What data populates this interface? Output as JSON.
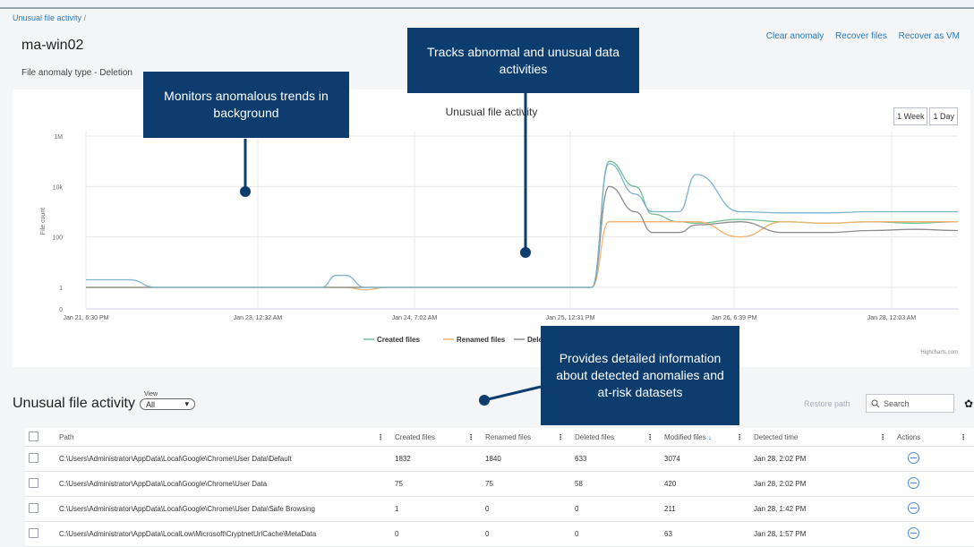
{
  "breadcrumb": {
    "item": "Unusual file activity",
    "separator": "/"
  },
  "page": {
    "title": "ma-win02",
    "subtitle": "File anomaly type - Deletion"
  },
  "top_actions": [
    "Clear anomaly",
    "Recover files",
    "Recover as VM"
  ],
  "chart_buttons": [
    "1 Week",
    "1 Day"
  ],
  "credits": "Highcharts.com",
  "chart_data": {
    "type": "line",
    "title": "Unusual file activity",
    "ylabel": "File count",
    "yscale": "log",
    "yticks": [
      {
        "label": "0",
        "value": 0
      },
      {
        "label": "1",
        "value": 1
      },
      {
        "label": "100",
        "value": 100
      },
      {
        "label": "10k",
        "value": 10000
      },
      {
        "label": "1M",
        "value": 1000000
      }
    ],
    "xticks": [
      "Jan 21, 6:30 PM",
      "Jan 23, 12:32 AM",
      "Jan 24, 7:02 AM",
      "Jan 25, 12:31 PM",
      "Jan 26, 6:39 PM",
      "Jan 28, 12:03 AM"
    ],
    "x_index": [
      0,
      0.8,
      1.0,
      1.6,
      1.8,
      3.0,
      3.3,
      3.7,
      4.0,
      4.5,
      5.0,
      5.4,
      5.75,
      5.95,
      6.4,
      6.9,
      7.3,
      7.9,
      8.6,
      9.5,
      10.0,
      10.7,
      11.2,
      11.6,
      12.0,
      12.6,
      13.0,
      13.6,
      14.0,
      15.0,
      16.0,
      17.0,
      18.0,
      19.0,
      20.0
    ],
    "series": [
      {
        "name": "Created files",
        "color": "#6fbf95",
        "values": [
          0,
          0,
          0,
          0,
          0,
          0,
          0,
          0,
          0,
          0,
          0,
          0,
          0,
          0,
          0,
          0,
          0,
          0,
          0,
          0,
          0,
          0,
          0,
          0,
          0,
          0,
          0,
          0,
          0,
          0,
          0,
          0,
          0,
          0,
          0
        ]
      },
      {
        "name": "Renamed files",
        "color": "#f2b36d",
        "values": [
          0,
          0,
          0,
          0,
          0,
          0,
          0,
          0,
          0,
          0,
          0,
          0,
          0,
          0,
          0,
          0,
          0,
          0,
          0,
          0,
          0,
          0,
          0,
          0,
          0,
          0,
          0,
          0,
          0,
          0,
          0,
          0,
          0,
          0,
          0
        ]
      },
      {
        "name": "Deleted files",
        "color": "#8c8c8c",
        "values": [
          0,
          0,
          0,
          0,
          0,
          0,
          0,
          0,
          0,
          0,
          0,
          0,
          0,
          0,
          0,
          0,
          0,
          0,
          0,
          0,
          0,
          0,
          0,
          0,
          0,
          0,
          0,
          0,
          0,
          0,
          0,
          0,
          0,
          0,
          0
        ]
      },
      {
        "name": "Modified files",
        "color": "#7db3cf",
        "values": [
          0,
          0,
          0,
          0,
          0,
          0,
          0,
          0,
          0,
          0,
          0,
          0,
          0,
          0,
          0,
          0,
          0,
          0,
          0,
          0,
          0,
          0,
          0,
          0,
          0,
          0,
          0,
          0,
          0,
          0,
          0,
          0,
          0,
          0,
          0
        ]
      }
    ],
    "legend_visible": [
      "Created files",
      "Renamed files",
      "Deleted"
    ],
    "legend_position": "bottom-center",
    "grid": true
  },
  "table": {
    "heading": "Unusual file activity",
    "view_label": "View",
    "view_value": "All",
    "restore": "Restore path",
    "search_placeholder": "Search",
    "columns": [
      "Path",
      "Created files",
      "Renamed files",
      "Deleted files",
      "Modified files",
      "Detected time",
      "Actions"
    ],
    "sort_indicator": "↓",
    "rows": [
      {
        "path": "C:\\Users\\Administrator\\AppData\\Local\\Google\\Chrome\\User Data\\Default",
        "created": "1832",
        "renamed": "1840",
        "deleted": "633",
        "modified": "3074",
        "time": "Jan 28, 2:02 PM"
      },
      {
        "path": "C:\\Users\\Administrator\\AppData\\Local\\Google\\Chrome\\User Data",
        "created": "75",
        "renamed": "75",
        "deleted": "58",
        "modified": "420",
        "time": "Jan 28, 2:02 PM"
      },
      {
        "path": "C:\\Users\\Administrator\\AppData\\Local\\Google\\Chrome\\User Data\\Safe Browsing",
        "created": "1",
        "renamed": "0",
        "deleted": "0",
        "modified": "211",
        "time": "Jan 28, 1:42 PM"
      },
      {
        "path": "C:\\Users\\Administrator\\AppData\\LocalLow\\Microsoft\\CryptnetUrlCache\\MetaData",
        "created": "0",
        "renamed": "0",
        "deleted": "0",
        "modified": "63",
        "time": "Jan 28, 1:57 PM"
      }
    ]
  },
  "callouts": [
    {
      "text": "Monitors anomalous trends in background"
    },
    {
      "text": "Tracks abnormal and unusual data activities"
    },
    {
      "text": "Provides detailed information about detected anomalies and at-risk datasets"
    }
  ]
}
